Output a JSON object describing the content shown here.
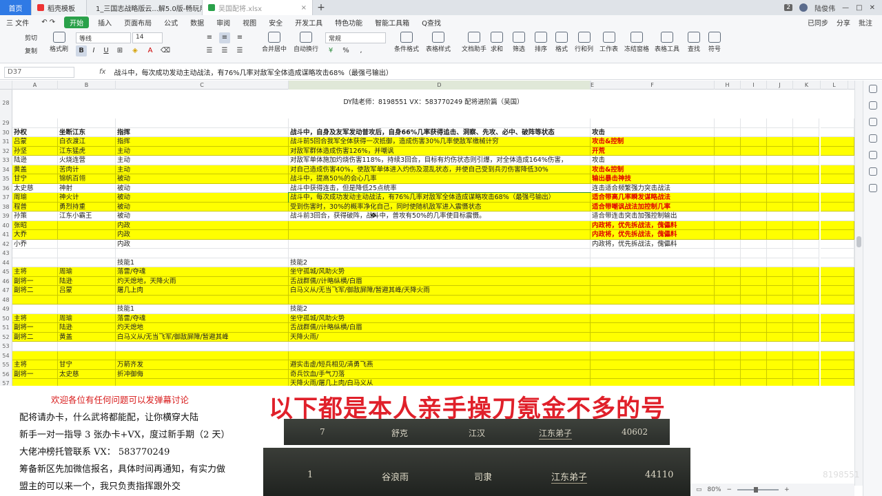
{
  "tabs": {
    "home": "首页",
    "tab1": "稻壳模板",
    "tab2": "1_三国志战略版云...解5.0版-畅玩用",
    "tab3": "吴国配将.xlsx",
    "close": "×",
    "add": "+"
  },
  "window": {
    "badge": "2",
    "user": "陆俊伟"
  },
  "menu": {
    "file": "三 文件",
    "items": [
      "开始",
      "插入",
      "页面布局",
      "公式",
      "数据",
      "审阅",
      "视图",
      "安全",
      "开发工具",
      "特色功能",
      "智能工具箱",
      "Q查找"
    ],
    "right": [
      "已同步",
      "分享",
      "批注"
    ]
  },
  "ribbon": {
    "cut": "剪切",
    "copy": "复制",
    "format_painter": "格式刷",
    "paste": "粘贴",
    "font_name": "等线",
    "font_size": "14",
    "bold": "B",
    "italic": "I",
    "underline": "U",
    "merge": "合并居中",
    "wrap": "自动换行",
    "number_format": "常规",
    "cond_format": "条件格式",
    "table_style": "表格样式",
    "doc_assist": "文档助手",
    "sum": "求和",
    "filter": "筛选",
    "sort": "排序",
    "format": "格式",
    "rowcol": "行和列",
    "worksheet": "工作表",
    "freeze": "冻结窗格",
    "table_tools": "表格工具",
    "find": "查找",
    "symbol": "符号"
  },
  "formula_bar": {
    "name_box": "D37",
    "fx": "fx",
    "content": "战斗中，每次成功发动主动战法，有76%几率对敌军全体造成谋略攻击68%（最强弓输出）"
  },
  "columns": [
    "A",
    "B",
    "C",
    "D",
    "E",
    "F",
    "H",
    "I",
    "J",
    "K",
    "L"
  ],
  "sheet": {
    "title_row": {
      "rownum": "28",
      "text": "DY陆老师：8198551 VX：583770249   配将进阶篇（吴国）"
    },
    "rows": [
      {
        "n": "29",
        "a": "",
        "b": "",
        "c": "",
        "d": "",
        "f": "",
        "style": "plain"
      },
      {
        "n": "30",
        "a": "孙权",
        "b": "坐断江东",
        "c": "指挥",
        "d": "战斗中，自身及友军发动普攻后，自身66%几率获得追击、洞察、先攻、必中、破阵等状态",
        "f": "攻击",
        "style": "bold"
      },
      {
        "n": "31",
        "a": "吕蒙",
        "b": "白衣渡江",
        "c": "指挥",
        "d": "战斗前5回合我军全体获得一次抵御，造成伤害30%几率使敌军缴械计穷",
        "f": "攻击&控制",
        "fred": true,
        "style": "yellow"
      },
      {
        "n": "32",
        "a": "孙坚",
        "b": "江东猛虎",
        "c": "主动",
        "d": "对敌军群体造成伤害126%，并嘲讽",
        "f": "开荒",
        "fred": true,
        "style": "yellow"
      },
      {
        "n": "33",
        "a": "陆逊",
        "b": "火烧连营",
        "c": "主动",
        "d": "对敌军单体施加灼烧伤害118%，持续3回合，目标有灼伤状态则引爆，对全体造成164%伤害，",
        "f": "攻击",
        "style": "plain"
      },
      {
        "n": "34",
        "a": "黄盖",
        "b": "苦肉计",
        "c": "主动",
        "d": "对自己造成伤害40%，使敌军单体进入灼伤及混乱状态，并使自己受到兵刃伤害降低30%",
        "f": "攻击&控制",
        "fred": true,
        "style": "yellow"
      },
      {
        "n": "35",
        "a": "甘宁",
        "b": "锦帆百翎",
        "c": "被动",
        "d": "战斗中，提高50%的会心几率",
        "f": "输出暴击神技",
        "fred": true,
        "style": "yellow"
      },
      {
        "n": "36",
        "a": "太史慈",
        "b": "神射",
        "c": "被动",
        "d": "战斗中获得连击，但是降低25点统率",
        "f": "连击适合频繁强力突击战法",
        "style": "plain"
      },
      {
        "n": "37",
        "a": "周瑜",
        "b": "神火计",
        "c": "被动",
        "d": "战斗中，每次成功发动主动战法，有76%几率对敌军全体造成谋略攻击68%（最强弓输出）",
        "f": "适合带高几率瞬发谋略战法",
        "fred": true,
        "style": "yellow"
      },
      {
        "n": "38",
        "a": "程普",
        "b": "勇烈持重",
        "c": "被动",
        "d": "受到伤害时，30%的概率净化自己，同时使随机敌军进入震慑状态",
        "f": "适合带嘲讽战法加控制几率",
        "fred": true,
        "style": "yellow"
      },
      {
        "n": "39",
        "a": "孙策",
        "b": "江东小霸王",
        "c": "被动",
        "d": "战斗前3回合，获得破阵，战斗中，普攻有50%的几率使目标震慑。",
        "f": "适合带连击突击加强控制输出",
        "style": "plain"
      },
      {
        "n": "40",
        "a": "张昭",
        "b": "",
        "c": "内政",
        "d": "",
        "f": "内政将，优先拆战法，傀儡料",
        "fred": true,
        "style": "yellow"
      },
      {
        "n": "41",
        "a": "大乔",
        "b": "",
        "c": "内政",
        "d": "",
        "f": "内政将，优先拆战法，傀儡料",
        "fred": true,
        "style": "yellow"
      },
      {
        "n": "42",
        "a": "小乔",
        "b": "",
        "c": "内政",
        "d": "",
        "f": "内政将，优先拆战法，傀儡料",
        "style": "plain"
      },
      {
        "n": "43",
        "a": "",
        "b": "",
        "c": "",
        "d": "",
        "f": "",
        "style": "plain"
      },
      {
        "n": "44",
        "a": "",
        "b": "",
        "c": "技能1",
        "d": "技能2",
        "f": "",
        "style": "plain"
      },
      {
        "n": "45",
        "a": "主将",
        "b": "周瑜",
        "c": "落雷/夺魂",
        "d": "坐守孤城/风助火势",
        "f": "",
        "style": "yellow"
      },
      {
        "n": "46",
        "a": "副将一",
        "b": "陆逊",
        "c": "灼天熄地，天降火雨",
        "d": "舌战群儒//计略纵横/白眉",
        "f": "",
        "style": "yellow"
      },
      {
        "n": "47",
        "a": "副将二",
        "b": "吕蒙",
        "c": "屠几上肉",
        "d": "白马义从/无当飞军/御敌屏障/暂避其峰/天降火雨",
        "f": "",
        "style": "yellow"
      },
      {
        "n": "48",
        "a": "",
        "b": "",
        "c": "",
        "d": "",
        "f": "",
        "style": "yellow"
      },
      {
        "n": "49",
        "a": "",
        "b": "",
        "c": "技能1",
        "d": "技能2",
        "f": "",
        "style": "plain"
      },
      {
        "n": "50",
        "a": "主将",
        "b": "周瑜",
        "c": "落雷/夺魂",
        "d": "坐守孤城/风助火势",
        "f": "",
        "style": "yellow"
      },
      {
        "n": "51",
        "a": "副将一",
        "b": "陆逊",
        "c": "灼天熄地",
        "d": "舌战群儒//计略纵横/白眉",
        "f": "",
        "style": "yellow"
      },
      {
        "n": "52",
        "a": "副将二",
        "b": "黄盖",
        "c": "白马义从/无当飞军/御敌屏障/暂避其峰",
        "d": "天降火雨/",
        "f": "",
        "style": "yellow"
      },
      {
        "n": "53",
        "a": "",
        "b": "",
        "c": "",
        "d": "",
        "f": "",
        "style": "plain"
      },
      {
        "n": "54",
        "a": "",
        "b": "",
        "c": "",
        "d": "",
        "f": "",
        "style": "yellow"
      },
      {
        "n": "55",
        "a": "主将",
        "b": "甘宁",
        "c": "万箭齐发",
        "d": "避实击虚/短兵相见/清勇飞燕",
        "f": "",
        "style": "yellow"
      },
      {
        "n": "56",
        "a": "副将一",
        "b": "太史慈",
        "c": "折冲御侮",
        "d": "奇兵饮血/手气刀落",
        "f": "",
        "style": "yellow"
      },
      {
        "n": "57",
        "a": "",
        "b": "",
        "c": "",
        "d": "天降火雨/屠几上肉/白马义从",
        "f": "",
        "style": "yellow"
      }
    ]
  },
  "overlay": {
    "lines": [
      "欢迎各位有任何问题可以发弹幕讨论",
      "配将请办卡，什么武将都能配，让你横穿大陆",
      "新手一对一指导 3 张办卡+VX，度过新手期（2 天）",
      "大佬冲榜托管联系 VX： 583770249",
      "筹备新区先加微信报名，具体时间再通知，有实力做",
      "盟主的可以来一个，我只负责指挥跟外交"
    ],
    "headline": "以下都是本人亲手操刀氪金不多的号",
    "game_row1": {
      "rank": "7",
      "name": "舒克",
      "region": "江汉",
      "group": "江东弟子",
      "power": "40602"
    },
    "game_row2": {
      "rank": "1",
      "name": "谷浪雨",
      "region": "司隶",
      "group": "江东弟子",
      "power": "44110"
    },
    "watermark": "8198551"
  },
  "status": {
    "zoom": "80%",
    "minus": "−",
    "plus": "+"
  },
  "colors": {
    "yellow": "#ffff00",
    "red": "#e00000",
    "tab_blue": "#2f7ae5",
    "start_green": "#2aa14a"
  }
}
